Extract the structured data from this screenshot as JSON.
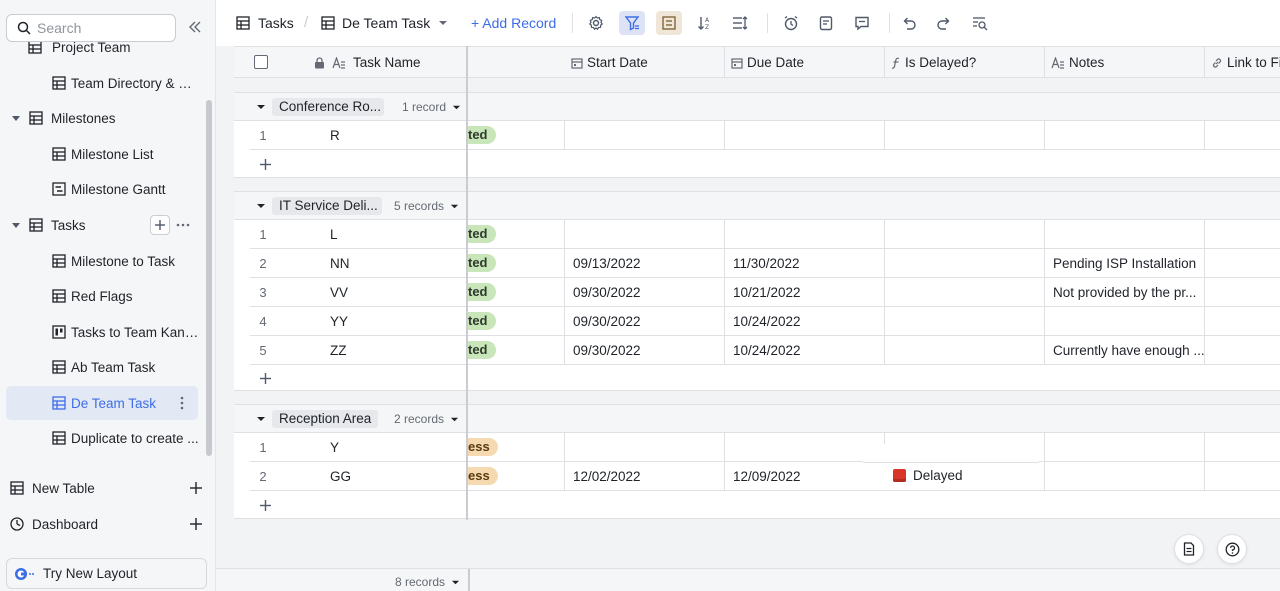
{
  "sidebar": {
    "search_placeholder": "Search",
    "items": [
      {
        "label": "Project Team",
        "level": 2
      },
      {
        "label": "Team Directory & Pr...",
        "level": 2
      },
      {
        "label": "Milestones",
        "level": 1
      },
      {
        "label": "Milestone List",
        "level": 2
      },
      {
        "label": "Milestone Gantt",
        "level": 2
      },
      {
        "label": "Tasks",
        "level": 1
      },
      {
        "label": "Milestone to Task",
        "level": 2
      },
      {
        "label": "Red Flags",
        "level": 2
      },
      {
        "label": "Tasks to Team Kanb...",
        "level": 2
      },
      {
        "label": "Ab Team Task",
        "level": 2
      },
      {
        "label": "De Team Task",
        "level": 2,
        "active": true
      },
      {
        "label": "Duplicate to create ...",
        "level": 2
      }
    ],
    "new_table": "New Table",
    "dashboard": "Dashboard",
    "try_layout": "Try New Layout"
  },
  "toolbar": {
    "table_name": "Tasks",
    "view_name": "De Team Task",
    "add_record": "+ Add Record"
  },
  "columns": {
    "task_name": "Task Name",
    "start_date": "Start Date",
    "due_date": "Due Date",
    "is_delayed": "Is Delayed?",
    "notes": "Notes",
    "link": "Link to Fi"
  },
  "groups": [
    {
      "title": "Conference Ro...",
      "count": "1 record",
      "rows": [
        {
          "num": "1",
          "name": "R",
          "status": "ted",
          "status_color": "green",
          "start": "",
          "due": "",
          "delayed": "",
          "notes": ""
        }
      ]
    },
    {
      "title": "IT Service Deli...",
      "count": "5 records",
      "rows": [
        {
          "num": "1",
          "name": "L",
          "status": "ted",
          "status_color": "green",
          "start": "",
          "due": "",
          "delayed": "",
          "notes": ""
        },
        {
          "num": "2",
          "name": "NN",
          "status": "ted",
          "status_color": "green",
          "start": "09/13/2022",
          "due": "11/30/2022",
          "delayed": "",
          "notes": "Pending ISP Installation"
        },
        {
          "num": "3",
          "name": "VV",
          "status": "ted",
          "status_color": "green",
          "start": "09/30/2022",
          "due": "10/21/2022",
          "delayed": "",
          "notes": "Not provided by the pr..."
        },
        {
          "num": "4",
          "name": "YY",
          "status": "ted",
          "status_color": "green",
          "start": "09/30/2022",
          "due": "10/24/2022",
          "delayed": "",
          "notes": ""
        },
        {
          "num": "5",
          "name": "ZZ",
          "status": "ted",
          "status_color": "green",
          "start": "09/30/2022",
          "due": "10/24/2022",
          "delayed": "",
          "notes": "Currently have enough ..."
        }
      ]
    },
    {
      "title": "Reception Area",
      "count": "2 records",
      "rows": [
        {
          "num": "1",
          "name": "Y",
          "status": "ess",
          "status_color": "orange",
          "start": "",
          "due": "",
          "delayed": "",
          "notes": ""
        },
        {
          "num": "2",
          "name": "GG",
          "status": "ess",
          "status_color": "orange",
          "start": "12/02/2022",
          "due": "12/09/2022",
          "delayed": "Delayed",
          "notes": ""
        }
      ]
    }
  ],
  "footer": {
    "total": "8 records"
  },
  "colors": {
    "accent": "#3d6ce7",
    "delayed_square": "#d9362b",
    "tag_green": "#c8e6b9",
    "tag_orange": "#f5d9b0"
  }
}
